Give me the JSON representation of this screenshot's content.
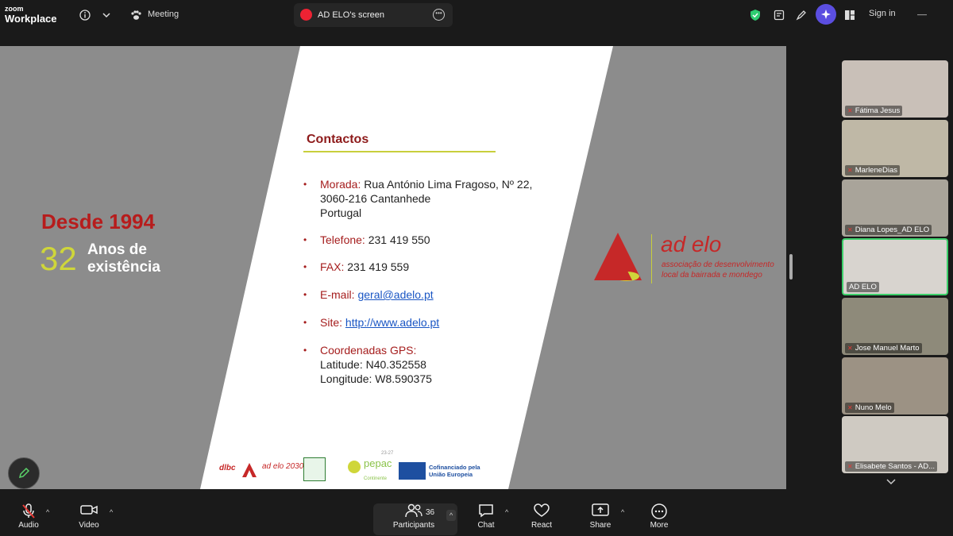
{
  "app": {
    "logo_line1": "zoom",
    "logo_line2": "Workplace"
  },
  "topbar": {
    "meeting_label": "Meeting",
    "screen_tab_label": "AD ELO's screen",
    "signin_label": "Sign in",
    "shield_color": "#2ecc71",
    "ai_color": "#6c5ce7"
  },
  "slide": {
    "since": "Desde 1994",
    "years_number": "32",
    "years_text_1": "Anos de",
    "years_text_2": "existência",
    "contacts_title": "Contactos",
    "items": [
      {
        "label": "Morada:",
        "lines": [
          "Rua António Lima Fragoso, Nº 22,",
          "3060-216 Cantanhede",
          "Portugal"
        ]
      },
      {
        "label": "Telefone:",
        "value": "231 419 550"
      },
      {
        "label": "FAX:",
        "value": "231 419 559"
      },
      {
        "label": "E-mail:",
        "link": "geral@adelo.pt"
      },
      {
        "label": "Site:",
        "link": "http://www.adelo.pt"
      },
      {
        "label": "Coordenadas GPS:",
        "lines": [
          "Latitude: N40.352558",
          "Longitude: W8.590375"
        ]
      }
    ],
    "brand": "ad elo",
    "tagline_1": "associação de desenvolvimento",
    "tagline_2": "local da bairrada e mondego",
    "footer": {
      "dlbc": "dlbc",
      "adelo2030": "ad elo 2030",
      "pepac": "pepac",
      "pepac_year": "23-27",
      "continente": "Continente",
      "eu_line1": "Cofinanciado pela",
      "eu_line2": "União Europeia"
    }
  },
  "participants": [
    {
      "name": "Fátima Jesus",
      "muted": true
    },
    {
      "name": "MarleneDias",
      "muted": true
    },
    {
      "name": "Diana Lopes_AD ELO",
      "muted": true
    },
    {
      "name": "AD ELO",
      "muted": false,
      "active": true
    },
    {
      "name": "Jose Manuel Marto",
      "muted": true
    },
    {
      "name": "Nuno Melo",
      "muted": true
    },
    {
      "name": "Elisabete Santos - AD...",
      "muted": true
    }
  ],
  "toolbar": {
    "audio": "Audio",
    "video": "Video",
    "participants": "Participants",
    "participant_count": "36",
    "chat": "Chat",
    "react": "React",
    "share": "Share",
    "more": "More"
  }
}
